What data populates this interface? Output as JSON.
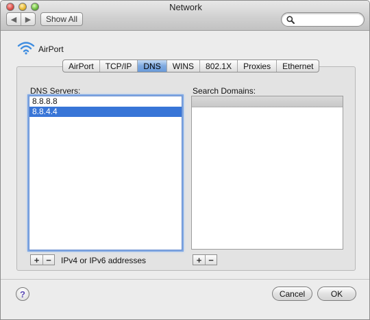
{
  "window": {
    "title": "Network"
  },
  "toolbar": {
    "back_glyph": "◀",
    "forward_glyph": "▶",
    "show_all_label": "Show All",
    "search_placeholder": ""
  },
  "interface": {
    "name": "AirPort",
    "icon": "wifi-icon"
  },
  "tabs": [
    {
      "label": "AirPort",
      "selected": false
    },
    {
      "label": "TCP/IP",
      "selected": false
    },
    {
      "label": "DNS",
      "selected": true
    },
    {
      "label": "WINS",
      "selected": false
    },
    {
      "label": "802.1X",
      "selected": false
    },
    {
      "label": "Proxies",
      "selected": false
    },
    {
      "label": "Ethernet",
      "selected": false
    }
  ],
  "dns": {
    "label": "DNS Servers:",
    "servers": [
      "8.8.8.8",
      "8.8.4.4"
    ],
    "selected_index": 1,
    "hint": "IPv4 or IPv6 addresses"
  },
  "search_domains": {
    "label": "Search Domains:",
    "domains": []
  },
  "controls": {
    "plus": "+",
    "minus": "−"
  },
  "footer": {
    "help_glyph": "?",
    "cancel_label": "Cancel",
    "ok_label": "OK"
  },
  "colors": {
    "selection": "#3875d7",
    "tab_selected": "#7ea9e0",
    "focus_ring": "#7fa7e3"
  }
}
